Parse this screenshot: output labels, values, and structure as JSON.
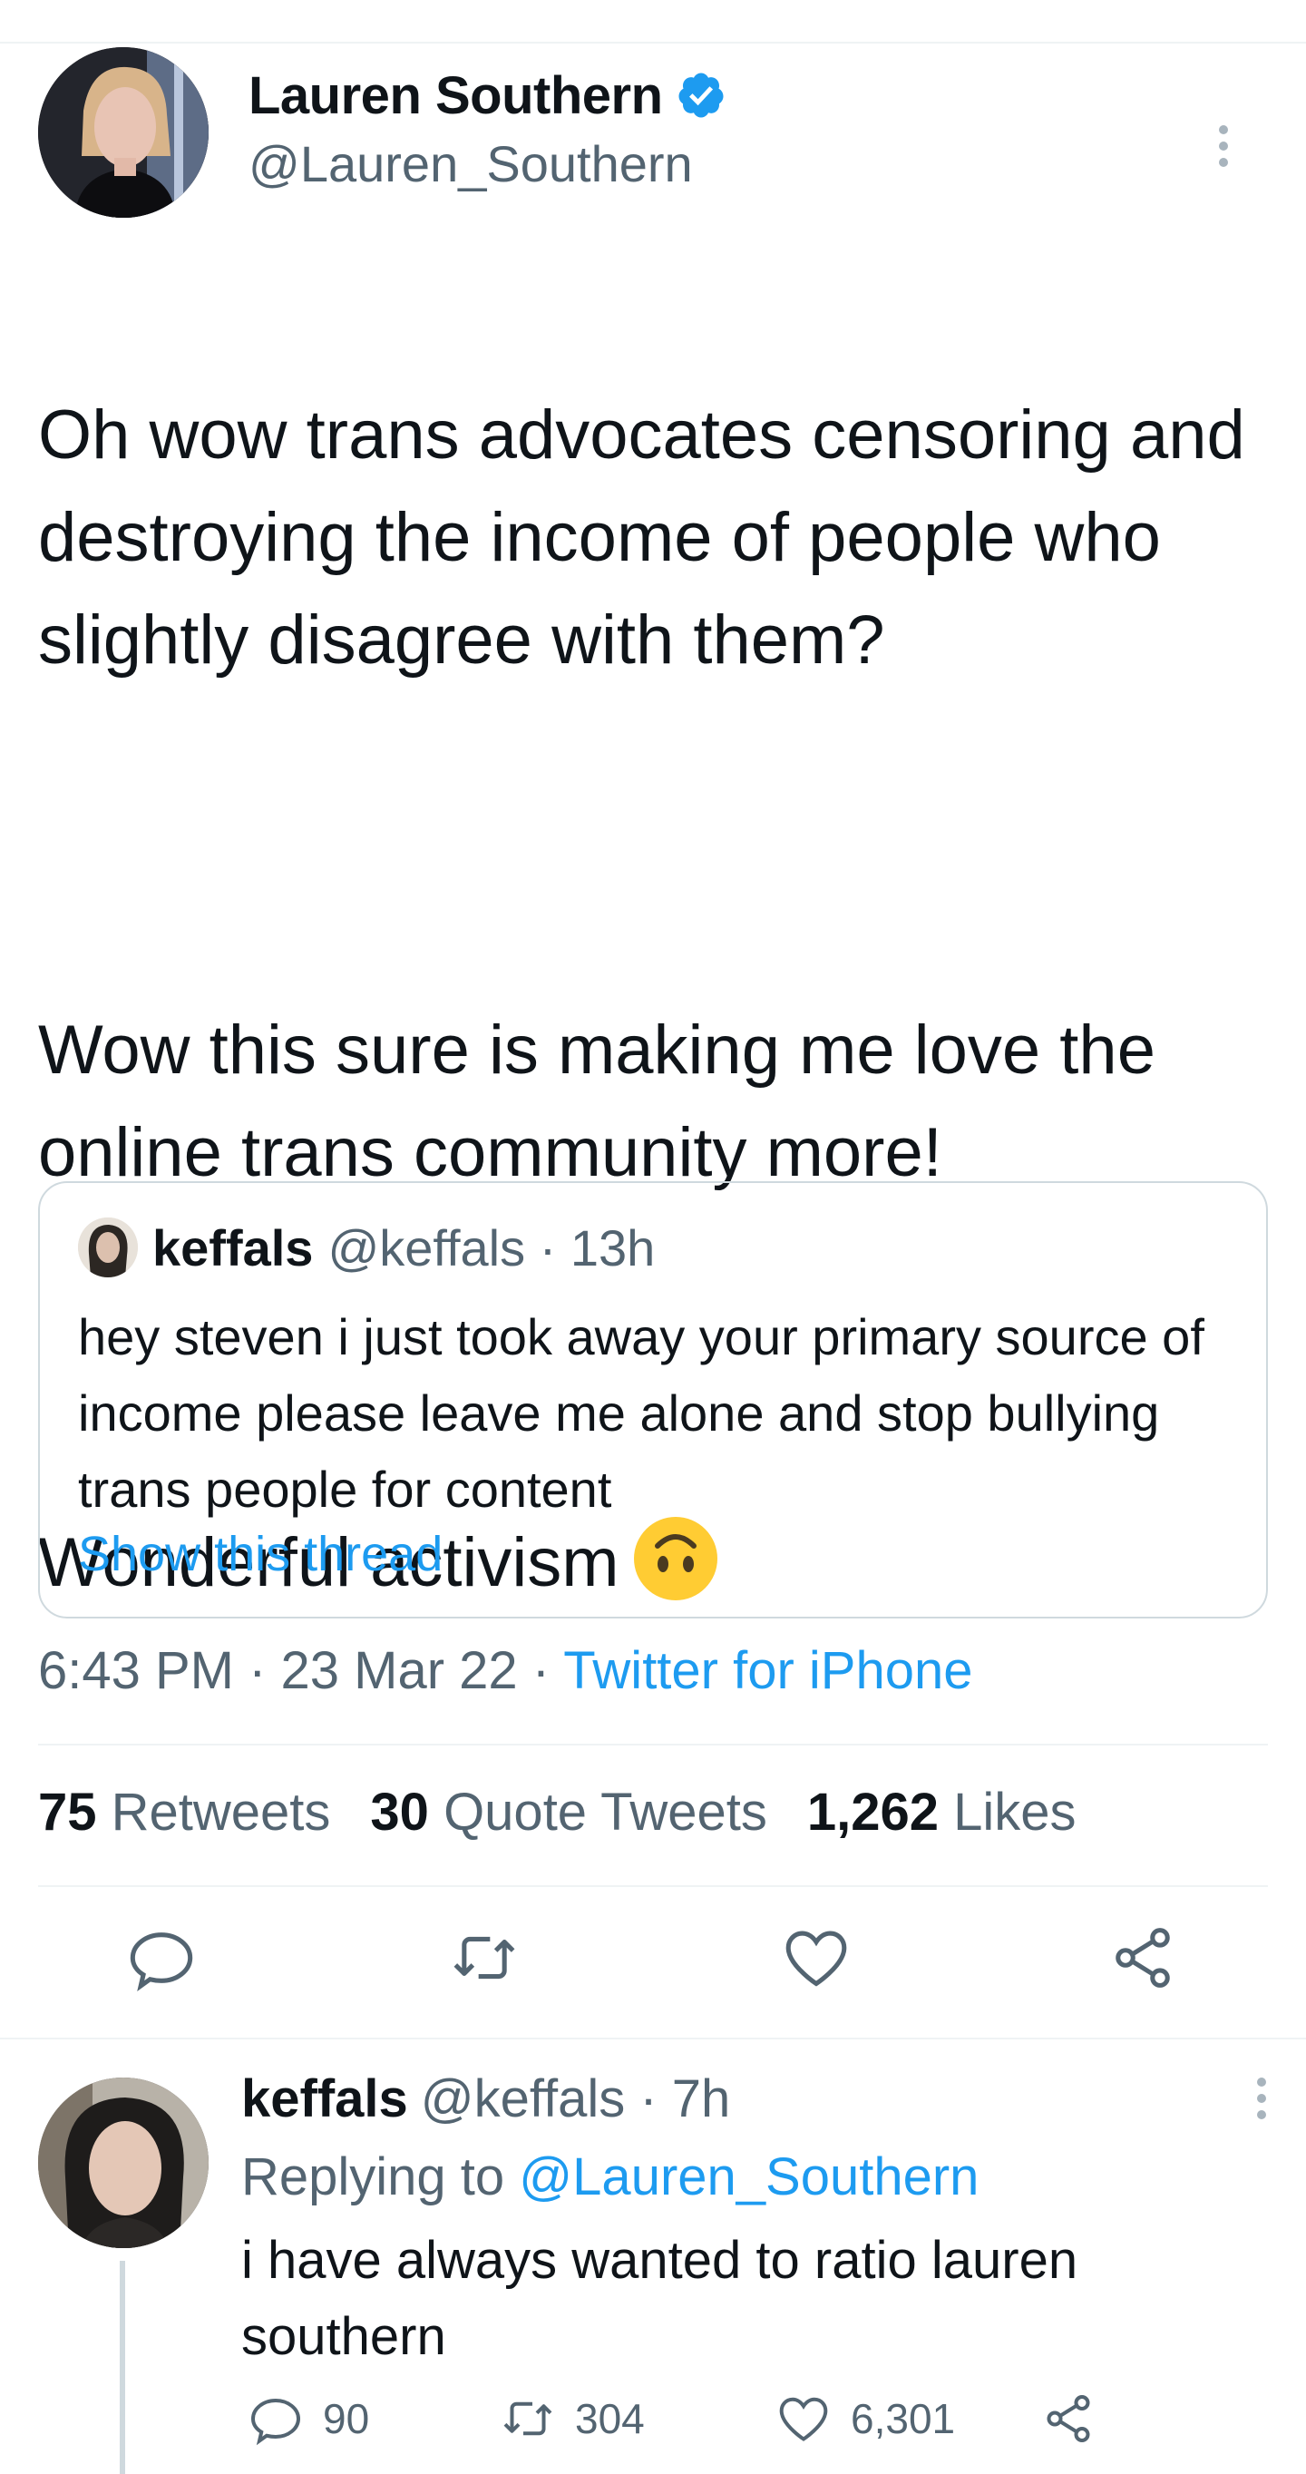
{
  "main_tweet": {
    "author_name": "Lauren Southern",
    "author_handle": "@Lauren_Southern",
    "paragraphs": [
      "Oh wow trans advocates censoring and destroying the income of people who slightly disagree with them?",
      "Wow this sure is making me love the online trans community more!",
      "Wonderful activism"
    ],
    "emoji": "upside-down-face",
    "timestamp": "6:43 PM · 23 Mar 22 · ",
    "source": "Twitter for iPhone",
    "stats": {
      "retweets_count": "75",
      "retweets_label": "Retweets",
      "quotes_count": "30",
      "quotes_label": "Quote Tweets",
      "likes_count": "1,262",
      "likes_label": "Likes"
    }
  },
  "quoted_tweet": {
    "author_name": "keffals",
    "meta": "@keffals · 13h",
    "text": "hey steven i just took away your primary source of income please leave me alone and stop bullying trans people for content",
    "show_thread": "Show this thread"
  },
  "reply": {
    "author_name": "keffals",
    "meta": "@keffals · 7h",
    "replying_label": "Replying to ",
    "replying_handle": "@Lauren_Southern",
    "text": "i have always wanted to ratio lauren southern",
    "replies": "90",
    "retweets": "304",
    "likes": "6,301"
  },
  "colors": {
    "link": "#1d9bf0",
    "secondary": "#536471",
    "verified": "#1d9bf0",
    "emoji": "#ffcc33"
  }
}
